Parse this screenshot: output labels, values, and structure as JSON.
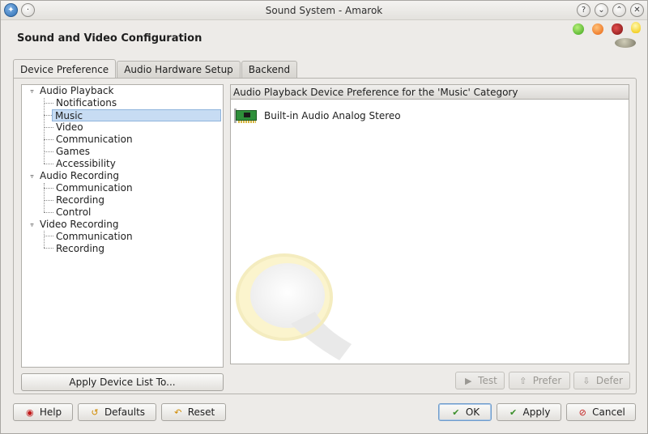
{
  "window": {
    "title": "Sound System - Amarok"
  },
  "header": {
    "title": "Sound and Video Configuration"
  },
  "tabs": [
    {
      "label": "Device Preference",
      "active": true
    },
    {
      "label": "Audio Hardware Setup",
      "active": false
    },
    {
      "label": "Backend",
      "active": false
    }
  ],
  "tree": {
    "groups": [
      {
        "label": "Audio Playback",
        "children": [
          "Notifications",
          "Music",
          "Video",
          "Communication",
          "Games",
          "Accessibility"
        ]
      },
      {
        "label": "Audio Recording",
        "children": [
          "Communication",
          "Recording",
          "Control"
        ]
      },
      {
        "label": "Video Recording",
        "children": [
          "Communication",
          "Recording"
        ]
      }
    ],
    "selected": "Music",
    "expander_symbol": "▿"
  },
  "device_panel": {
    "header": "Audio Playback Device Preference for the 'Music' Category",
    "devices": [
      "Built-in Audio Analog Stereo"
    ]
  },
  "buttons": {
    "apply_device_list": "Apply Device List To...",
    "test": "Test",
    "prefer": "Prefer",
    "defer": "Defer",
    "help": "Help",
    "defaults": "Defaults",
    "reset": "Reset",
    "ok": "OK",
    "apply": "Apply",
    "cancel": "Cancel"
  },
  "icons": {
    "test": "play-circle-icon",
    "prefer": "up-arrow-icon",
    "defer": "down-arrow-icon",
    "help": "help-icon",
    "defaults": "restore-icon",
    "reset": "undo-icon",
    "ok": "check-icon",
    "apply": "check-icon",
    "cancel": "cancel-icon"
  },
  "colors": {
    "selection": "#c7dcf3",
    "ok_check": "#3b8f2a",
    "cancel_red": "#c21b1b"
  }
}
